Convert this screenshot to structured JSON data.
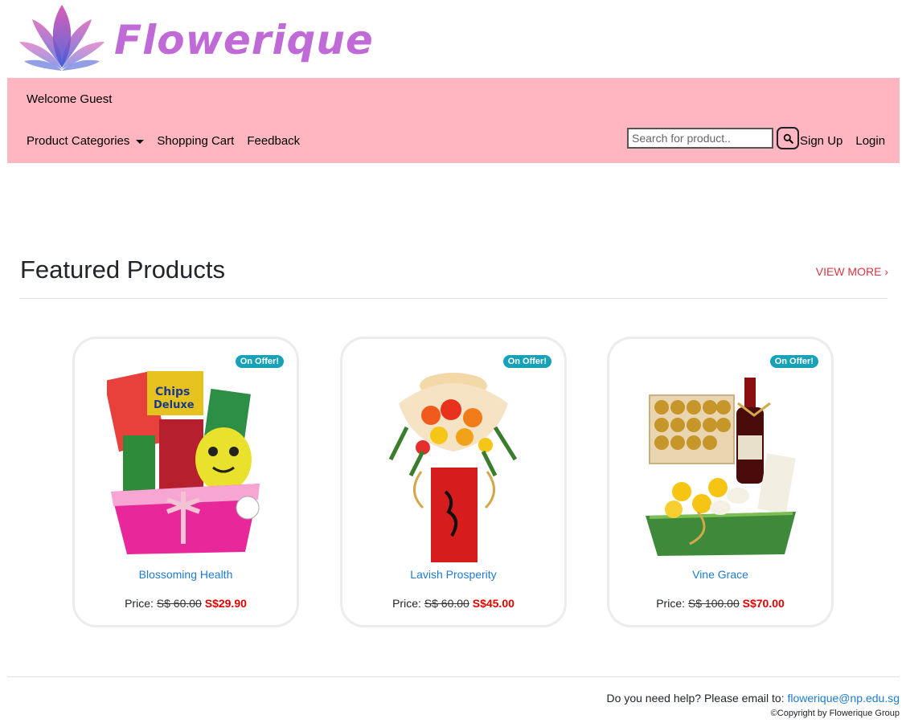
{
  "brand": {
    "name": "Flowerique"
  },
  "navbar": {
    "welcome": "Welcome Guest",
    "links": [
      "Product Categories",
      "Shopping Cart",
      "Feedback"
    ],
    "search_placeholder": "Search for product..",
    "right_links": [
      "Sign Up",
      "Login"
    ],
    "background": "#ffb6c1"
  },
  "featured": {
    "title": "Featured Products",
    "view_more": "VIEW MORE ›"
  },
  "products": [
    {
      "badge": "On Offer!",
      "name": "Blossoming Health",
      "price_label": "Price:",
      "old_price": "S$ 60.00",
      "new_price": "S$29.90"
    },
    {
      "badge": "On Offer!",
      "name": "Lavish Prosperity",
      "price_label": "Price:",
      "old_price": "S$ 60.00",
      "new_price": "S$45.00"
    },
    {
      "badge": "On Offer!",
      "name": "Vine Grace",
      "price_label": "Price:",
      "old_price": "S$ 100.00",
      "new_price": "S$70.00"
    }
  ],
  "footer": {
    "help_text": "Do you need help? Please email to:",
    "email": "flowerique@np.edu.sg",
    "copyright": "©Copyright by Flowerique Group"
  },
  "colors": {
    "accent": "#dc3545",
    "link": "#1e7bd1",
    "badge": "#17a2b8",
    "brand": "#c06ad8"
  }
}
